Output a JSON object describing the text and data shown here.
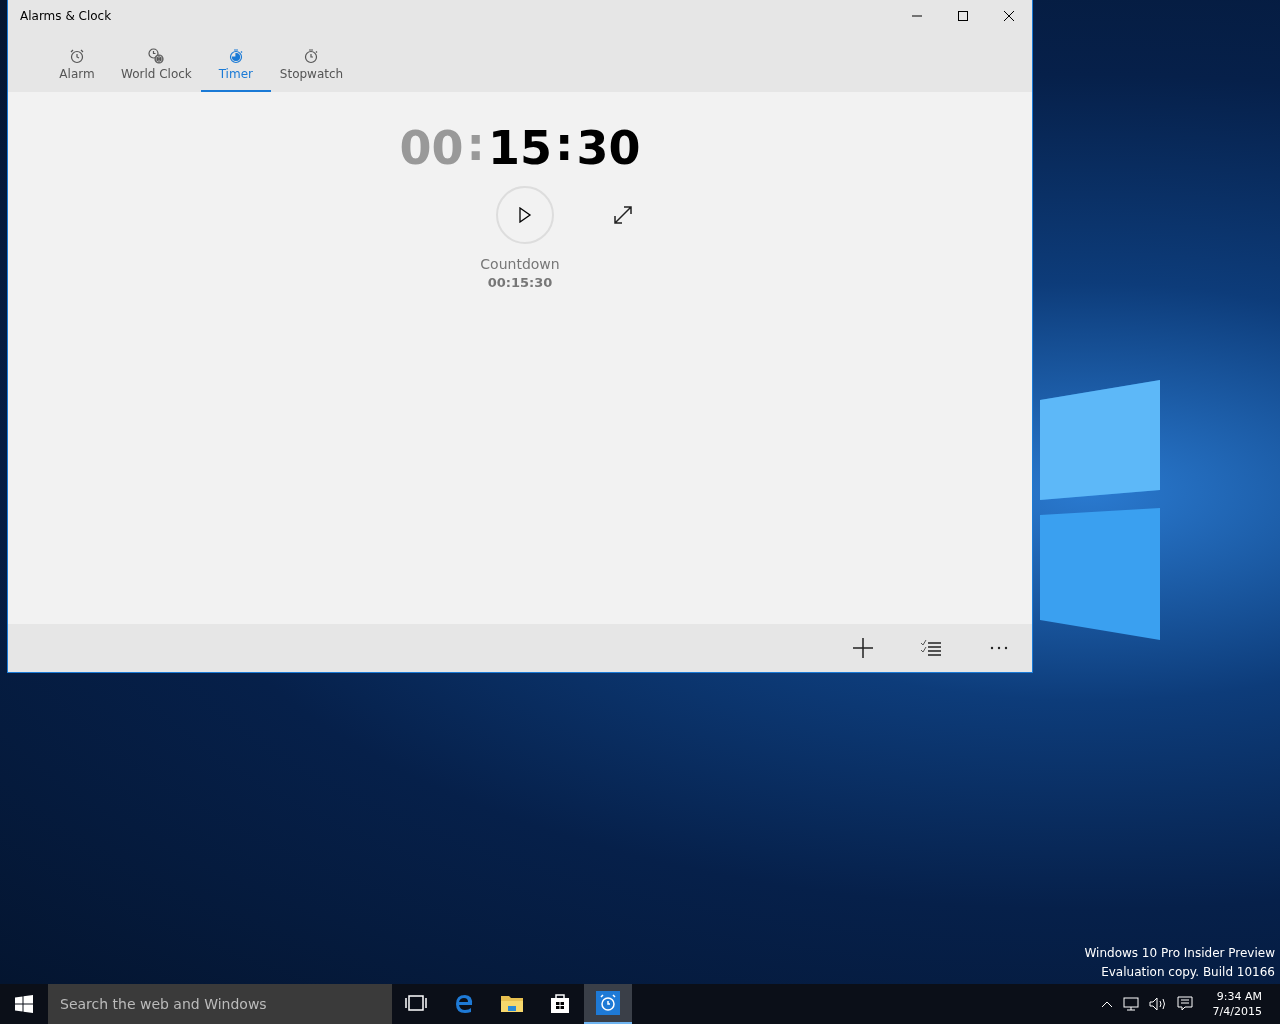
{
  "window": {
    "title": "Alarms & Clock"
  },
  "tabs": [
    {
      "label": "Alarm",
      "kind": "alarm",
      "selected": false
    },
    {
      "label": "World Clock",
      "kind": "world",
      "selected": false
    },
    {
      "label": "Timer",
      "kind": "timer",
      "selected": true
    },
    {
      "label": "Stopwatch",
      "kind": "stopwatch",
      "selected": false
    }
  ],
  "timer": {
    "display": [
      {
        "text": "00",
        "dim": true
      },
      {
        "text": ":",
        "dim": true
      },
      {
        "text": "15",
        "dim": false
      },
      {
        "text": ":",
        "dim": false
      },
      {
        "text": "30",
        "dim": false
      }
    ],
    "name": "Countdown",
    "duration": "00:15:30"
  },
  "desktop": {
    "watermark_lines": [
      "Windows 10 Pro Insider Preview",
      "Evaluation copy. Build 10166"
    ]
  },
  "taskbar": {
    "search": {
      "placeholder": "Search the web and Windows"
    },
    "apps": [
      {
        "kind": "taskview",
        "active": false
      },
      {
        "kind": "browser",
        "active": false
      },
      {
        "kind": "folder",
        "active": false
      },
      {
        "kind": "store",
        "active": false
      },
      {
        "kind": "alarm",
        "active": true
      }
    ],
    "time": "9:34 AM",
    "date": "7/4/2015"
  }
}
